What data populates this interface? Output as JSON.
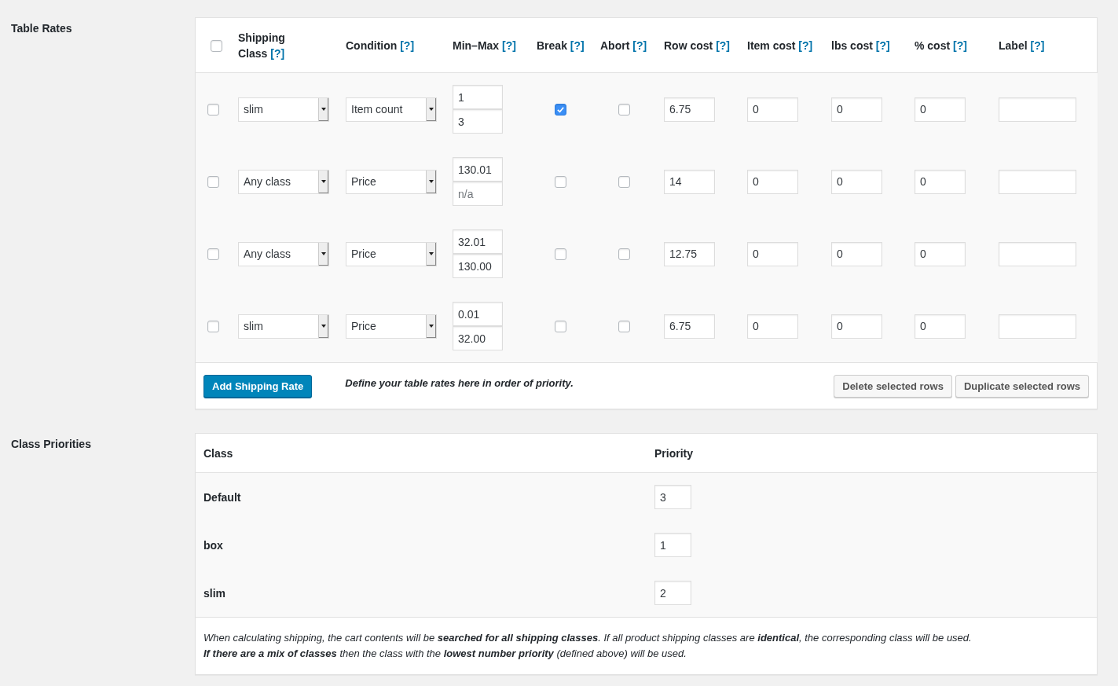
{
  "table_rates": {
    "heading": "Table Rates",
    "select_all": {
      "checked": false
    },
    "columns": [
      {
        "label": "Shipping Class",
        "help": "[?]"
      },
      {
        "label": "Condition",
        "help": "[?]"
      },
      {
        "label": "Min–Max",
        "help": "[?]"
      },
      {
        "label": "Break",
        "help": "[?]"
      },
      {
        "label": "Abort",
        "help": "[?]"
      },
      {
        "label": "Row cost",
        "help": "[?]"
      },
      {
        "label": "Item cost",
        "help": "[?]"
      },
      {
        "label": "lbs cost",
        "help": "[?]"
      },
      {
        "label": "% cost",
        "help": "[?]"
      },
      {
        "label": "Label",
        "help": "[?]"
      }
    ],
    "rows": [
      {
        "checked": false,
        "shipping_class": "slim",
        "condition": "Item count",
        "min": "1",
        "max": "3",
        "break": true,
        "abort": false,
        "row_cost": "6.75",
        "item_cost": "0",
        "lbs_cost": "0",
        "percent_cost": "0"
      },
      {
        "checked": false,
        "shipping_class": "Any class",
        "condition": "Price",
        "min": "130.01",
        "max_placeholder": "n/a",
        "break": false,
        "abort": false,
        "row_cost": "14",
        "item_cost": "0",
        "lbs_cost": "0",
        "percent_cost": "0"
      },
      {
        "checked": false,
        "shipping_class": "Any class",
        "condition": "Price",
        "min": "32.01",
        "max": "130.00",
        "break": false,
        "abort": false,
        "row_cost": "12.75",
        "item_cost": "0",
        "lbs_cost": "0",
        "percent_cost": "0"
      },
      {
        "checked": false,
        "shipping_class": "slim",
        "condition": "Price",
        "min": "0.01",
        "max": "32.00",
        "break": false,
        "abort": false,
        "row_cost": "6.75",
        "item_cost": "0",
        "lbs_cost": "0",
        "percent_cost": "0"
      }
    ],
    "add_button": "Add Shipping Rate",
    "note": "Define your table rates here in order of priority.",
    "buttons": [
      "Delete selected rows",
      "Duplicate selected rows"
    ]
  },
  "class_priorities": {
    "heading": "Class Priorities",
    "columns": [
      "Class",
      "Priority"
    ],
    "rows": [
      {
        "class": "Default",
        "priority": "3"
      },
      {
        "class": "box",
        "priority": "1"
      },
      {
        "class": "slim",
        "priority": "2"
      }
    ],
    "note": [
      "When calculating shipping, the cart contents will be **searched for all shipping classes**. If all product shipping classes are **identical**, the corresponding class will be used.",
      "**If there are a mix of classes** then the class with the **lowest number priority** (defined above) will be used."
    ]
  }
}
